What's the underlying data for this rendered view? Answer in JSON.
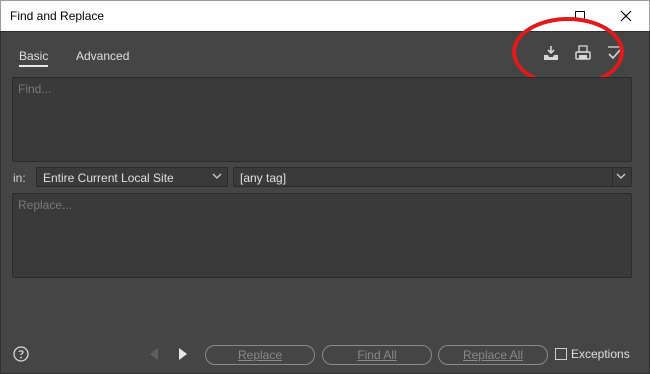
{
  "window": {
    "title": "Find and Replace"
  },
  "tabs": [
    {
      "label": "Basic",
      "active": true
    },
    {
      "label": "Advanced",
      "active": false
    }
  ],
  "toolbar": {
    "icons": [
      "save-query-icon",
      "open-query-icon",
      "check-icon"
    ],
    "annotation_color": "#e11a1a"
  },
  "find": {
    "placeholder": "Find..."
  },
  "scope": {
    "in_label": "in:",
    "selected": "Entire Current Local Site",
    "tag_selected": "[any tag]"
  },
  "replace": {
    "placeholder": "Replace..."
  },
  "buttons": {
    "replace": "Replace",
    "find_all": "Find All",
    "replace_all": "Replace All"
  },
  "exceptions": {
    "label": "Exceptions",
    "checked": false
  },
  "colors": {
    "panel_bg": "#454545",
    "field_bg": "#3a3a3a"
  }
}
